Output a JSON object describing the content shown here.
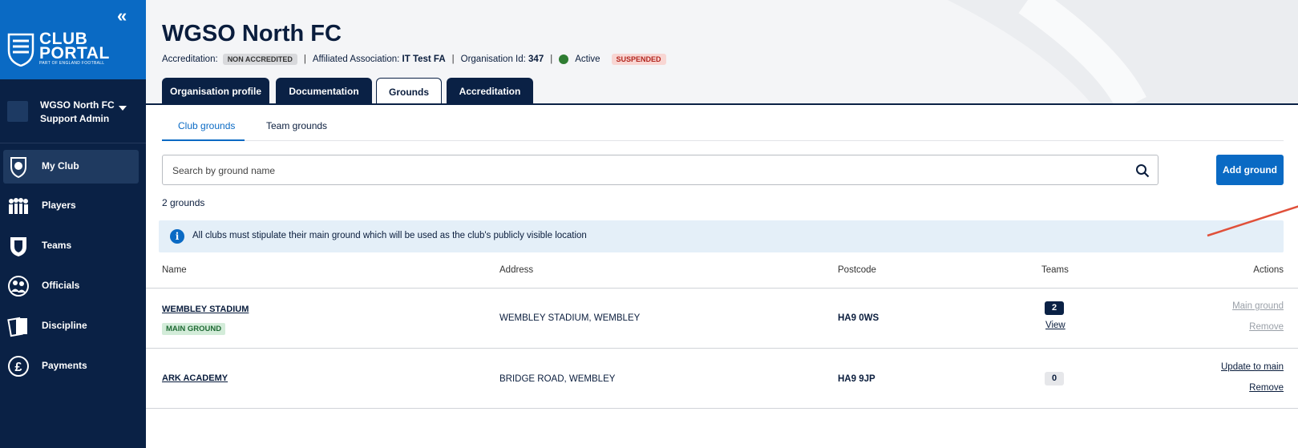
{
  "sidebar": {
    "logo_line1": "CLUB",
    "logo_line2": "PORTAL",
    "logo_sub": "PART OF ENGLAND FOOTBALL",
    "user_name": "WGSO North FC",
    "user_role": "Support Admin",
    "items": [
      {
        "label": "My Club",
        "icon": "shield-icon"
      },
      {
        "label": "Players",
        "icon": "players-icon"
      },
      {
        "label": "Teams",
        "icon": "teams-icon"
      },
      {
        "label": "Officials",
        "icon": "officials-icon"
      },
      {
        "label": "Discipline",
        "icon": "cards-icon"
      },
      {
        "label": "Payments",
        "icon": "pound-icon"
      }
    ]
  },
  "header": {
    "title": "WGSO North FC",
    "accreditation_label": "Accreditation:",
    "accreditation_value": "NON ACCREDITED",
    "affiliated_label": "Affiliated Association:",
    "affiliated_value": "IT Test FA",
    "org_id_label": "Organisation Id:",
    "org_id_value": "347",
    "status_text": "Active",
    "suspended_badge": "SUSPENDED",
    "tabs": [
      {
        "label": "Organisation profile"
      },
      {
        "label": "Documentation"
      },
      {
        "label": "Grounds"
      },
      {
        "label": "Accreditation"
      }
    ]
  },
  "subtabs": [
    {
      "label": "Club grounds"
    },
    {
      "label": "Team grounds"
    }
  ],
  "search": {
    "placeholder": "Search by ground name"
  },
  "add_button": "Add ground",
  "count_text": "2 grounds",
  "info_text": "All clubs must stipulate their main ground which will be used as the club's publicly visible location",
  "table": {
    "headers": [
      "Name",
      "Address",
      "Postcode",
      "Teams",
      "Actions"
    ],
    "rows": [
      {
        "name": "WEMBLEY STADIUM",
        "badge": "MAIN GROUND",
        "address": "WEMBLEY STADIUM, WEMBLEY",
        "postcode": "HA9 0WS",
        "teams": "2",
        "teams_link": "View",
        "action1": "Main ground",
        "action2": "Remove"
      },
      {
        "name": "ARK ACADEMY",
        "address": "BRIDGE ROAD, WEMBLEY",
        "postcode": "HA9 9JP",
        "teams": "0",
        "action1": "Update to main",
        "action2": "Remove"
      }
    ]
  },
  "colors": {
    "sidebar": "#0a2145",
    "brand_blue": "#0a6ac4",
    "annotation_arrow": "#e0503a"
  }
}
